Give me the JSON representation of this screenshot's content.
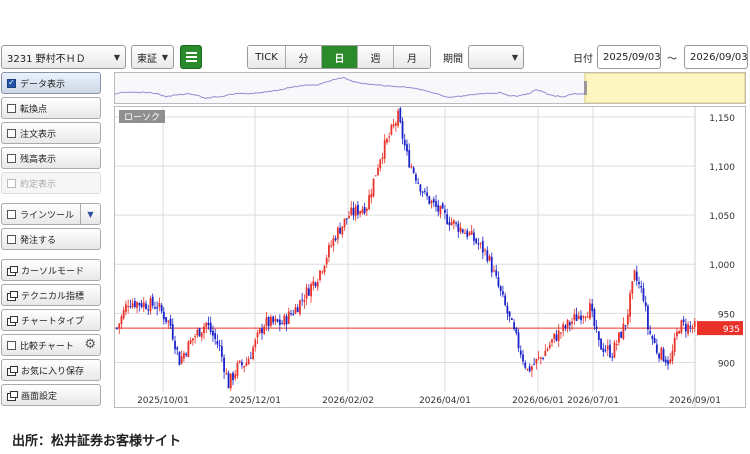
{
  "toolbar": {
    "stock_select": "3231 野村不ＨＤ",
    "market_select": "東証",
    "intervals": [
      "TICK",
      "分",
      "日",
      "週",
      "月"
    ],
    "active_interval": "日",
    "period_label": "期間",
    "period_value": "",
    "date_label": "日付",
    "date_from": "2025/09/03",
    "date_sep": "～",
    "date_to": "2026/09/03"
  },
  "sidebar": {
    "items": [
      {
        "label": "データ表示",
        "kind": "check",
        "checked": true
      },
      {
        "label": "転換点",
        "kind": "check",
        "checked": false
      },
      {
        "label": "注文表示",
        "kind": "check",
        "checked": false
      },
      {
        "label": "残高表示",
        "kind": "check",
        "checked": false
      },
      {
        "label": "約定表示",
        "kind": "check",
        "checked": false,
        "disabled": true
      },
      {
        "label": "ラインツール",
        "kind": "check-dropdown",
        "checked": false
      },
      {
        "label": "発注する",
        "kind": "check",
        "checked": false
      },
      {
        "label": "カーソルモード",
        "kind": "window"
      },
      {
        "label": "テクニカル指標",
        "kind": "window"
      },
      {
        "label": "チャートタイプ",
        "kind": "window"
      },
      {
        "label": "比較チャート",
        "kind": "check-gear",
        "checked": false
      },
      {
        "label": "お気に入り保存",
        "kind": "window"
      },
      {
        "label": "画面設定",
        "kind": "window"
      }
    ]
  },
  "chart": {
    "badge": "ローソク",
    "current_price": "935",
    "price_line": 935,
    "y_ticks": [
      "1,150",
      "1,100",
      "1,050",
      "1,000",
      "950",
      "900"
    ],
    "x_ticks": [
      "2025/10/01",
      "2025/12/01",
      "2026/02/02",
      "2026/04/01",
      "2026/06/01",
      "2026/07/01",
      "2026/09/01"
    ],
    "colors": {
      "up": "#e8322a",
      "down": "#1a22c8",
      "price_line": "#e8322a",
      "grid": "#dddddd",
      "nav_highlight": "#fdf6c3"
    }
  },
  "chart_data": {
    "type": "candlestick",
    "y_range": [
      870,
      1160
    ],
    "close_path": [
      [
        0,
        935
      ],
      [
        5,
        962
      ],
      [
        18,
        958
      ],
      [
        24,
        938
      ],
      [
        28,
        902
      ],
      [
        34,
        925
      ],
      [
        40,
        940
      ],
      [
        46,
        915
      ],
      [
        50,
        878
      ],
      [
        54,
        895
      ],
      [
        58,
        900
      ],
      [
        66,
        940
      ],
      [
        74,
        940
      ],
      [
        80,
        955
      ],
      [
        90,
        988
      ],
      [
        98,
        1030
      ],
      [
        104,
        1050
      ],
      [
        112,
        1060
      ],
      [
        118,
        1110
      ],
      [
        126,
        1150
      ],
      [
        130,
        1110
      ],
      [
        138,
        1070
      ],
      [
        146,
        1050
      ],
      [
        152,
        1040
      ],
      [
        158,
        1030
      ],
      [
        166,
        1010
      ],
      [
        172,
        970
      ],
      [
        178,
        930
      ],
      [
        184,
        892
      ],
      [
        190,
        905
      ],
      [
        196,
        925
      ],
      [
        202,
        938
      ],
      [
        208,
        950
      ],
      [
        212,
        955
      ],
      [
        216,
        918
      ],
      [
        222,
        910
      ],
      [
        228,
        940
      ],
      [
        232,
        988
      ],
      [
        236,
        968
      ],
      [
        238,
        935
      ],
      [
        242,
        913
      ],
      [
        248,
        900
      ],
      [
        252,
        938
      ],
      [
        260,
        935
      ]
    ]
  },
  "footer": "出所：松井証券お客様サイト"
}
